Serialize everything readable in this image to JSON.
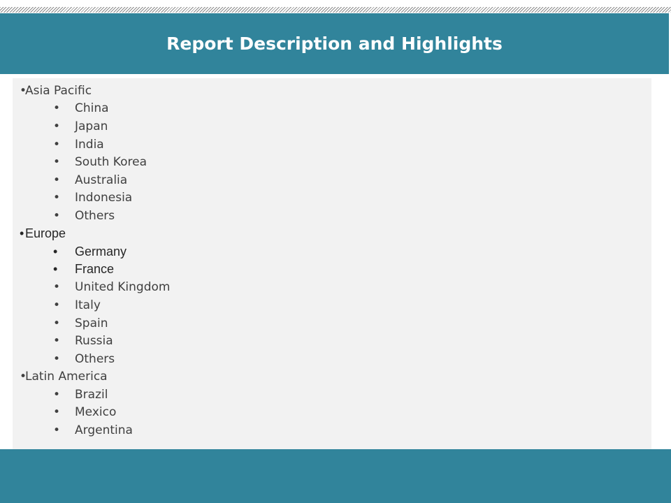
{
  "title": "Report Description and Highlights",
  "bullet_char": "•",
  "regions": [
    {
      "name": "Asia Pacific",
      "countries": [
        "China",
        "Japan",
        "India",
        "South Korea",
        "Australia",
        "Indonesia",
        "Others"
      ]
    },
    {
      "name": "Europe",
      "countries": [
        "Germany",
        "France",
        "United Kingdom",
        "Italy",
        "Spain",
        "Russia",
        "Others"
      ]
    },
    {
      "name": "Latin America",
      "countries": [
        "Brazil",
        "Mexico",
        "Argentina"
      ]
    }
  ],
  "colors": {
    "header_bg": "#31849b",
    "footer_bg": "#31849b",
    "content_bg": "#f2f2f2",
    "text": "#404040"
  }
}
